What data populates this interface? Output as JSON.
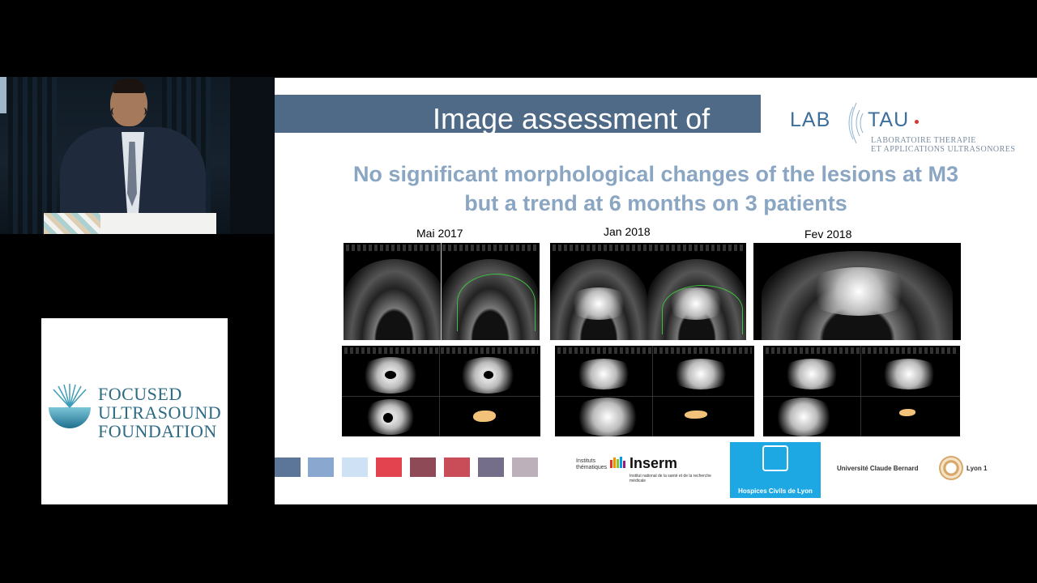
{
  "foundation_logo": {
    "lines": [
      "FOCUSED",
      "ULTRASOUND",
      "FOUNDATION"
    ]
  },
  "slide": {
    "title": "Image assessment of",
    "labtau": {
      "lab": "LAB",
      "tau": "TAU",
      "subtitle_line1": "LABORATOIRE THERAPIE",
      "subtitle_line2": "ET APPLICATIONS ULTRASONORES"
    },
    "headline_line1": "No significant morphological changes of the lesions at M3",
    "headline_line2": "but a trend at 6 months on 3 patients",
    "dates": [
      "Mai 2017",
      "Jan 2018",
      "Fev  2018"
    ],
    "colors": {
      "title_bar": "#4f6a86",
      "headline": "#8aa6c2",
      "swatches": [
        "#5b7698",
        "#89a7cf",
        "#cfe1f5",
        "#e3434f",
        "#8f4a57",
        "#c84d59",
        "#756e8a",
        "#bcb1ba"
      ]
    },
    "partner_logos": {
      "inserm": {
        "institutes_label": "Instituts thématiques",
        "name": "Inserm",
        "subtitle": "Institut national de la santé et de la recherche médicale"
      },
      "hcl": {
        "name": "Hospices Civils de Lyon"
      },
      "ucbl": {
        "name": "Université Claude Bernard",
        "suffix": "Lyon 1"
      }
    }
  }
}
